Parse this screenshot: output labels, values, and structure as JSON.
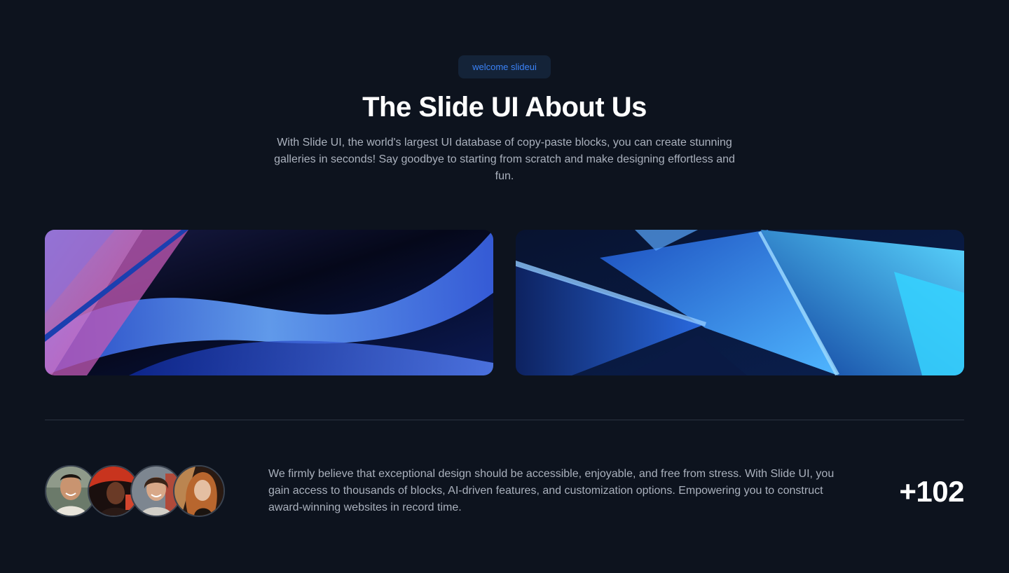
{
  "badge": {
    "label": "welcome slideui"
  },
  "hero": {
    "title": "The Slide UI About Us",
    "description": "With Slide UI, the world's largest UI database of copy-paste blocks, you can create stunning galleries in seconds! Say goodbye to starting from scratch and make designing effortless and fun."
  },
  "about": {
    "text": "We firmly believe that exceptional design should be accessible, enjoyable, and free from stress. With Slide UI, you gain access to thousands of blocks, AI-driven features, and customization options. Empowering you to construct award-winning websites in record time.",
    "count": "+102"
  },
  "colors": {
    "background": "#0d131e",
    "badge_bg": "#142338",
    "badge_text": "#3b82f6",
    "muted_text": "#aab1bd",
    "divider": "#2c3442"
  }
}
